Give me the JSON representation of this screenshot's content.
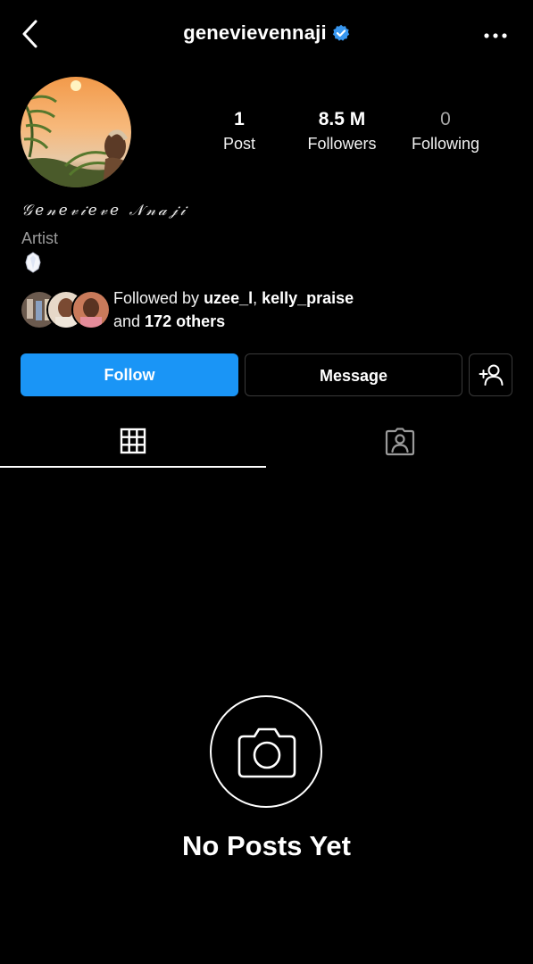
{
  "header": {
    "username": "genevievennaji",
    "verified": true,
    "icons": {
      "back": "chevron-left-icon",
      "verified": "verified-badge-icon",
      "more": "more-horizontal-icon"
    }
  },
  "profile": {
    "display_name": "𝒢𝑒𝓃𝑒𝓋𝒾𝑒𝓋𝑒 𝒩𝓃𝒶𝒿𝒾",
    "category": "Artist",
    "bio_emoji": "moonstone-icon"
  },
  "stats": {
    "posts": {
      "value": "1",
      "label": "Post"
    },
    "followers": {
      "value": "8.5 M",
      "label": "Followers"
    },
    "following": {
      "value": "0",
      "label": "Following"
    }
  },
  "followed_by": {
    "prefix": "Followed by ",
    "users": [
      "uzee_l",
      "kelly_praise"
    ],
    "separator": ", ",
    "and_text": "and ",
    "others": "172 others"
  },
  "actions": {
    "follow_label": "Follow",
    "message_label": "Message",
    "add_user_icon": "person-add-icon"
  },
  "tabs": [
    {
      "name": "grid",
      "icon": "grid-icon",
      "active": true
    },
    {
      "name": "tagged",
      "icon": "tagged-person-icon",
      "active": false
    }
  ],
  "empty_state": {
    "icon": "camera-icon",
    "title": "No Posts Yet"
  },
  "colors": {
    "background": "#000000",
    "primary_button": "#1a95f6",
    "verified_blue": "#3897f0",
    "muted_text": "#9b9b9b"
  }
}
